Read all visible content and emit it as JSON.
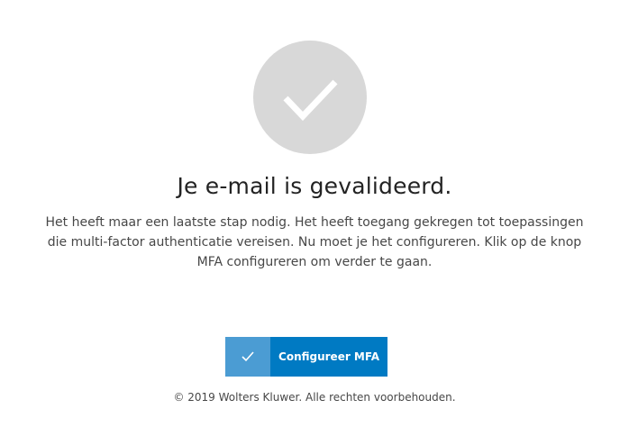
{
  "status": {
    "icon": "checkmark-circle-icon"
  },
  "main": {
    "title": "Je e-mail is gevalideerd.",
    "description": "Het heeft maar een laatste stap nodig. Het heeft toegang gekregen tot toepassingen die multi-factor authenticatie vereisen. Nu moet je het configureren. Klik op de knop MFA configureren om verder te gaan."
  },
  "actions": {
    "configure_mfa": {
      "label": "Configureer MFA",
      "icon": "checkmark-icon"
    }
  },
  "footer": {
    "copyright": "© 2019 Wolters Kluwer. Alle rechten voorbehouden."
  },
  "colors": {
    "primary_button": "#007ac3",
    "button_icon_area": "#4b9cd3",
    "check_circle": "#d8d8d8",
    "title_text": "#232323",
    "body_text": "#474747"
  }
}
